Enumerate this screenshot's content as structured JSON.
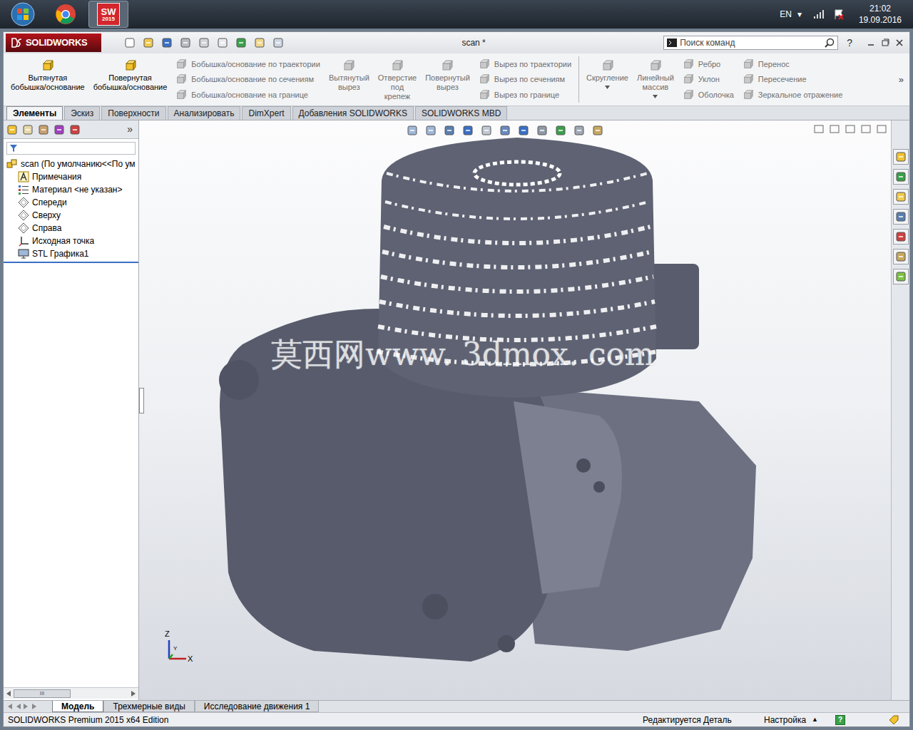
{
  "taskbar": {
    "apps": [
      {
        "kind": "start",
        "active": false
      },
      {
        "kind": "chrome",
        "active": false
      },
      {
        "kind": "solidworks",
        "label": "SW",
        "sublabel": "2015",
        "active": true
      }
    ],
    "language": "EN",
    "language_arrow": "▾",
    "time": "21:02",
    "date": "19.09.2016"
  },
  "window": {
    "logo": "SOLIDWORKS",
    "title": "scan *",
    "search_placeholder": "Поиск команд",
    "help": "?"
  },
  "command_manager": {
    "groups": [
      {
        "kind": "big",
        "label": "Вытянутая\nбобышка/основание",
        "disabled": false,
        "dropdown": false
      },
      {
        "kind": "big",
        "label": "Повернутая\nбобышка/основание",
        "disabled": false,
        "dropdown": false
      },
      {
        "kind": "stack",
        "items": [
          {
            "label": "Бобышка/основание по траектории",
            "disabled": true
          },
          {
            "label": "Бобышка/основание по сечениям",
            "disabled": true
          },
          {
            "label": "Бобышка/основание на границе",
            "disabled": true
          }
        ]
      },
      {
        "kind": "big",
        "label": "Вытянутый\nвырез",
        "disabled": true,
        "dropdown": false
      },
      {
        "kind": "big",
        "label": "Отверстие\nпод\nкрепеж",
        "disabled": true,
        "dropdown": false
      },
      {
        "kind": "big",
        "label": "Повернутый\nвырез",
        "disabled": true,
        "dropdown": false
      },
      {
        "kind": "stack",
        "items": [
          {
            "label": "Вырез по траектории",
            "disabled": true
          },
          {
            "label": "Вырез по сечениям",
            "disabled": true
          },
          {
            "label": "Вырез по границе",
            "disabled": true
          }
        ]
      },
      {
        "kind": "separator"
      },
      {
        "kind": "big",
        "label": "Скругление",
        "disabled": true,
        "dropdown": true
      },
      {
        "kind": "big",
        "label": "Линейный\nмассив",
        "disabled": true,
        "dropdown": true
      },
      {
        "kind": "stack",
        "items": [
          {
            "label": "Ребро",
            "disabled": true
          },
          {
            "label": "Уклон",
            "disabled": true
          },
          {
            "label": "Оболочка",
            "disabled": true
          }
        ]
      },
      {
        "kind": "stack",
        "items": [
          {
            "label": "Перенос",
            "disabled": true
          },
          {
            "label": "Пересечение",
            "disabled": true
          },
          {
            "label": "Зеркальное отражение",
            "disabled": true
          }
        ]
      }
    ],
    "more": "»"
  },
  "tabs": [
    {
      "label": "Элементы",
      "selected": true
    },
    {
      "label": "Эскиз",
      "selected": false
    },
    {
      "label": "Поверхности",
      "selected": false
    },
    {
      "label": "Анализировать",
      "selected": false
    },
    {
      "label": "DimXpert",
      "selected": false
    },
    {
      "label": "Добавления SOLIDWORKS",
      "selected": false
    },
    {
      "label": "SOLIDWORKS MBD",
      "selected": false
    }
  ],
  "feature_tree": {
    "header_more": "»",
    "root": {
      "label": "scan  (По умолчанию<<По ум",
      "kind": "part"
    },
    "items": [
      {
        "label": "Примечания",
        "kind": "annotations"
      },
      {
        "label": "Материал <не указан>",
        "kind": "material"
      },
      {
        "label": "Спереди",
        "kind": "plane"
      },
      {
        "label": "Сверху",
        "kind": "plane"
      },
      {
        "label": "Справа",
        "kind": "plane"
      },
      {
        "label": "Исходная точка",
        "kind": "origin"
      },
      {
        "label": "STL Графика1",
        "kind": "stl"
      }
    ],
    "scroll_thumb": "III"
  },
  "viewport": {
    "watermark": "莫西网www. 3dmox. com",
    "axes": {
      "z": "Z",
      "y": "Y",
      "x": "X"
    }
  },
  "bottom_tabs": [
    {
      "label": "Модель",
      "selected": true
    },
    {
      "label": "Трехмерные виды",
      "selected": false
    },
    {
      "label": "Исследование движения 1",
      "selected": false
    }
  ],
  "status_bar": {
    "edition": "SOLIDWORKS Premium 2015 x64 Edition",
    "mode": "Редактируется Деталь",
    "units": "Настройка",
    "units_arrow": "▲",
    "help": "?"
  }
}
